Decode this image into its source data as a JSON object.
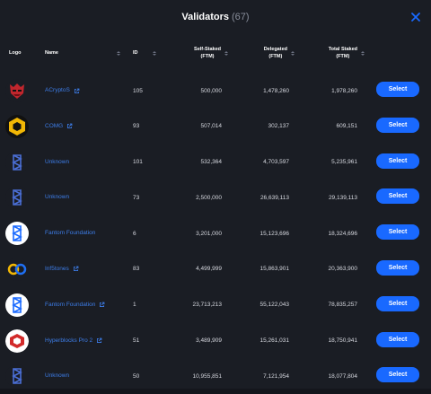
{
  "modal": {
    "title": "Validators",
    "count": "(67)"
  },
  "header": {
    "logo": "Logo",
    "name": "Name",
    "id": "ID",
    "self_staked": [
      "Self-Staked",
      "(FTM)"
    ],
    "delegated": [
      "Delegated",
      "(FTM)"
    ],
    "total_staked": [
      "Total Staked",
      "(FTM)"
    ]
  },
  "button_label": "Select",
  "colors": {
    "accent": "#1969ff",
    "link": "#3d7de8",
    "background": "#1a1d24"
  },
  "validators": [
    {
      "name": "ACryptoS",
      "ext_link": true,
      "logo_icon": "acryptos-mask-icon",
      "id": "105",
      "self": "500,000",
      "delegated": "1,478,260",
      "total": "1,978,260"
    },
    {
      "name": "COMG",
      "ext_link": true,
      "logo_icon": "comg-hex-icon",
      "id": "93",
      "self": "507,014",
      "delegated": "302,137",
      "total": "609,151"
    },
    {
      "name": "Unknown",
      "ext_link": false,
      "logo_icon": "fantom-icon",
      "id": "101",
      "self": "532,364",
      "delegated": "4,703,597",
      "total": "5,235,961"
    },
    {
      "name": "Unknown",
      "ext_link": false,
      "logo_icon": "fantom-icon",
      "id": "73",
      "self": "2,500,000",
      "delegated": "26,639,113",
      "total": "29,139,113"
    },
    {
      "name": "Fantom Foundation",
      "ext_link": false,
      "logo_icon": "fantom-foundation-icon",
      "id": "6",
      "self": "3,201,000",
      "delegated": "15,123,696",
      "total": "18,324,696"
    },
    {
      "name": "Inf5tones",
      "ext_link": true,
      "logo_icon": "infstones-icon",
      "id": "83",
      "self": "4,499,999",
      "delegated": "15,863,901",
      "total": "20,363,900"
    },
    {
      "name": "Fantom Foundation",
      "ext_link": true,
      "logo_icon": "fantom-foundation-icon",
      "id": "1",
      "self": "23,713,213",
      "delegated": "55,122,043",
      "total": "78,835,257"
    },
    {
      "name": "Hyperblocks Pro 2",
      "ext_link": true,
      "logo_icon": "hyperblocks-icon",
      "id": "51",
      "self": "3,489,909",
      "delegated": "15,261,031",
      "total": "18,750,941"
    },
    {
      "name": "Unknown",
      "ext_link": false,
      "logo_icon": "fantom-icon",
      "id": "50",
      "self": "10,955,851",
      "delegated": "7,121,954",
      "total": "18,077,804"
    }
  ]
}
